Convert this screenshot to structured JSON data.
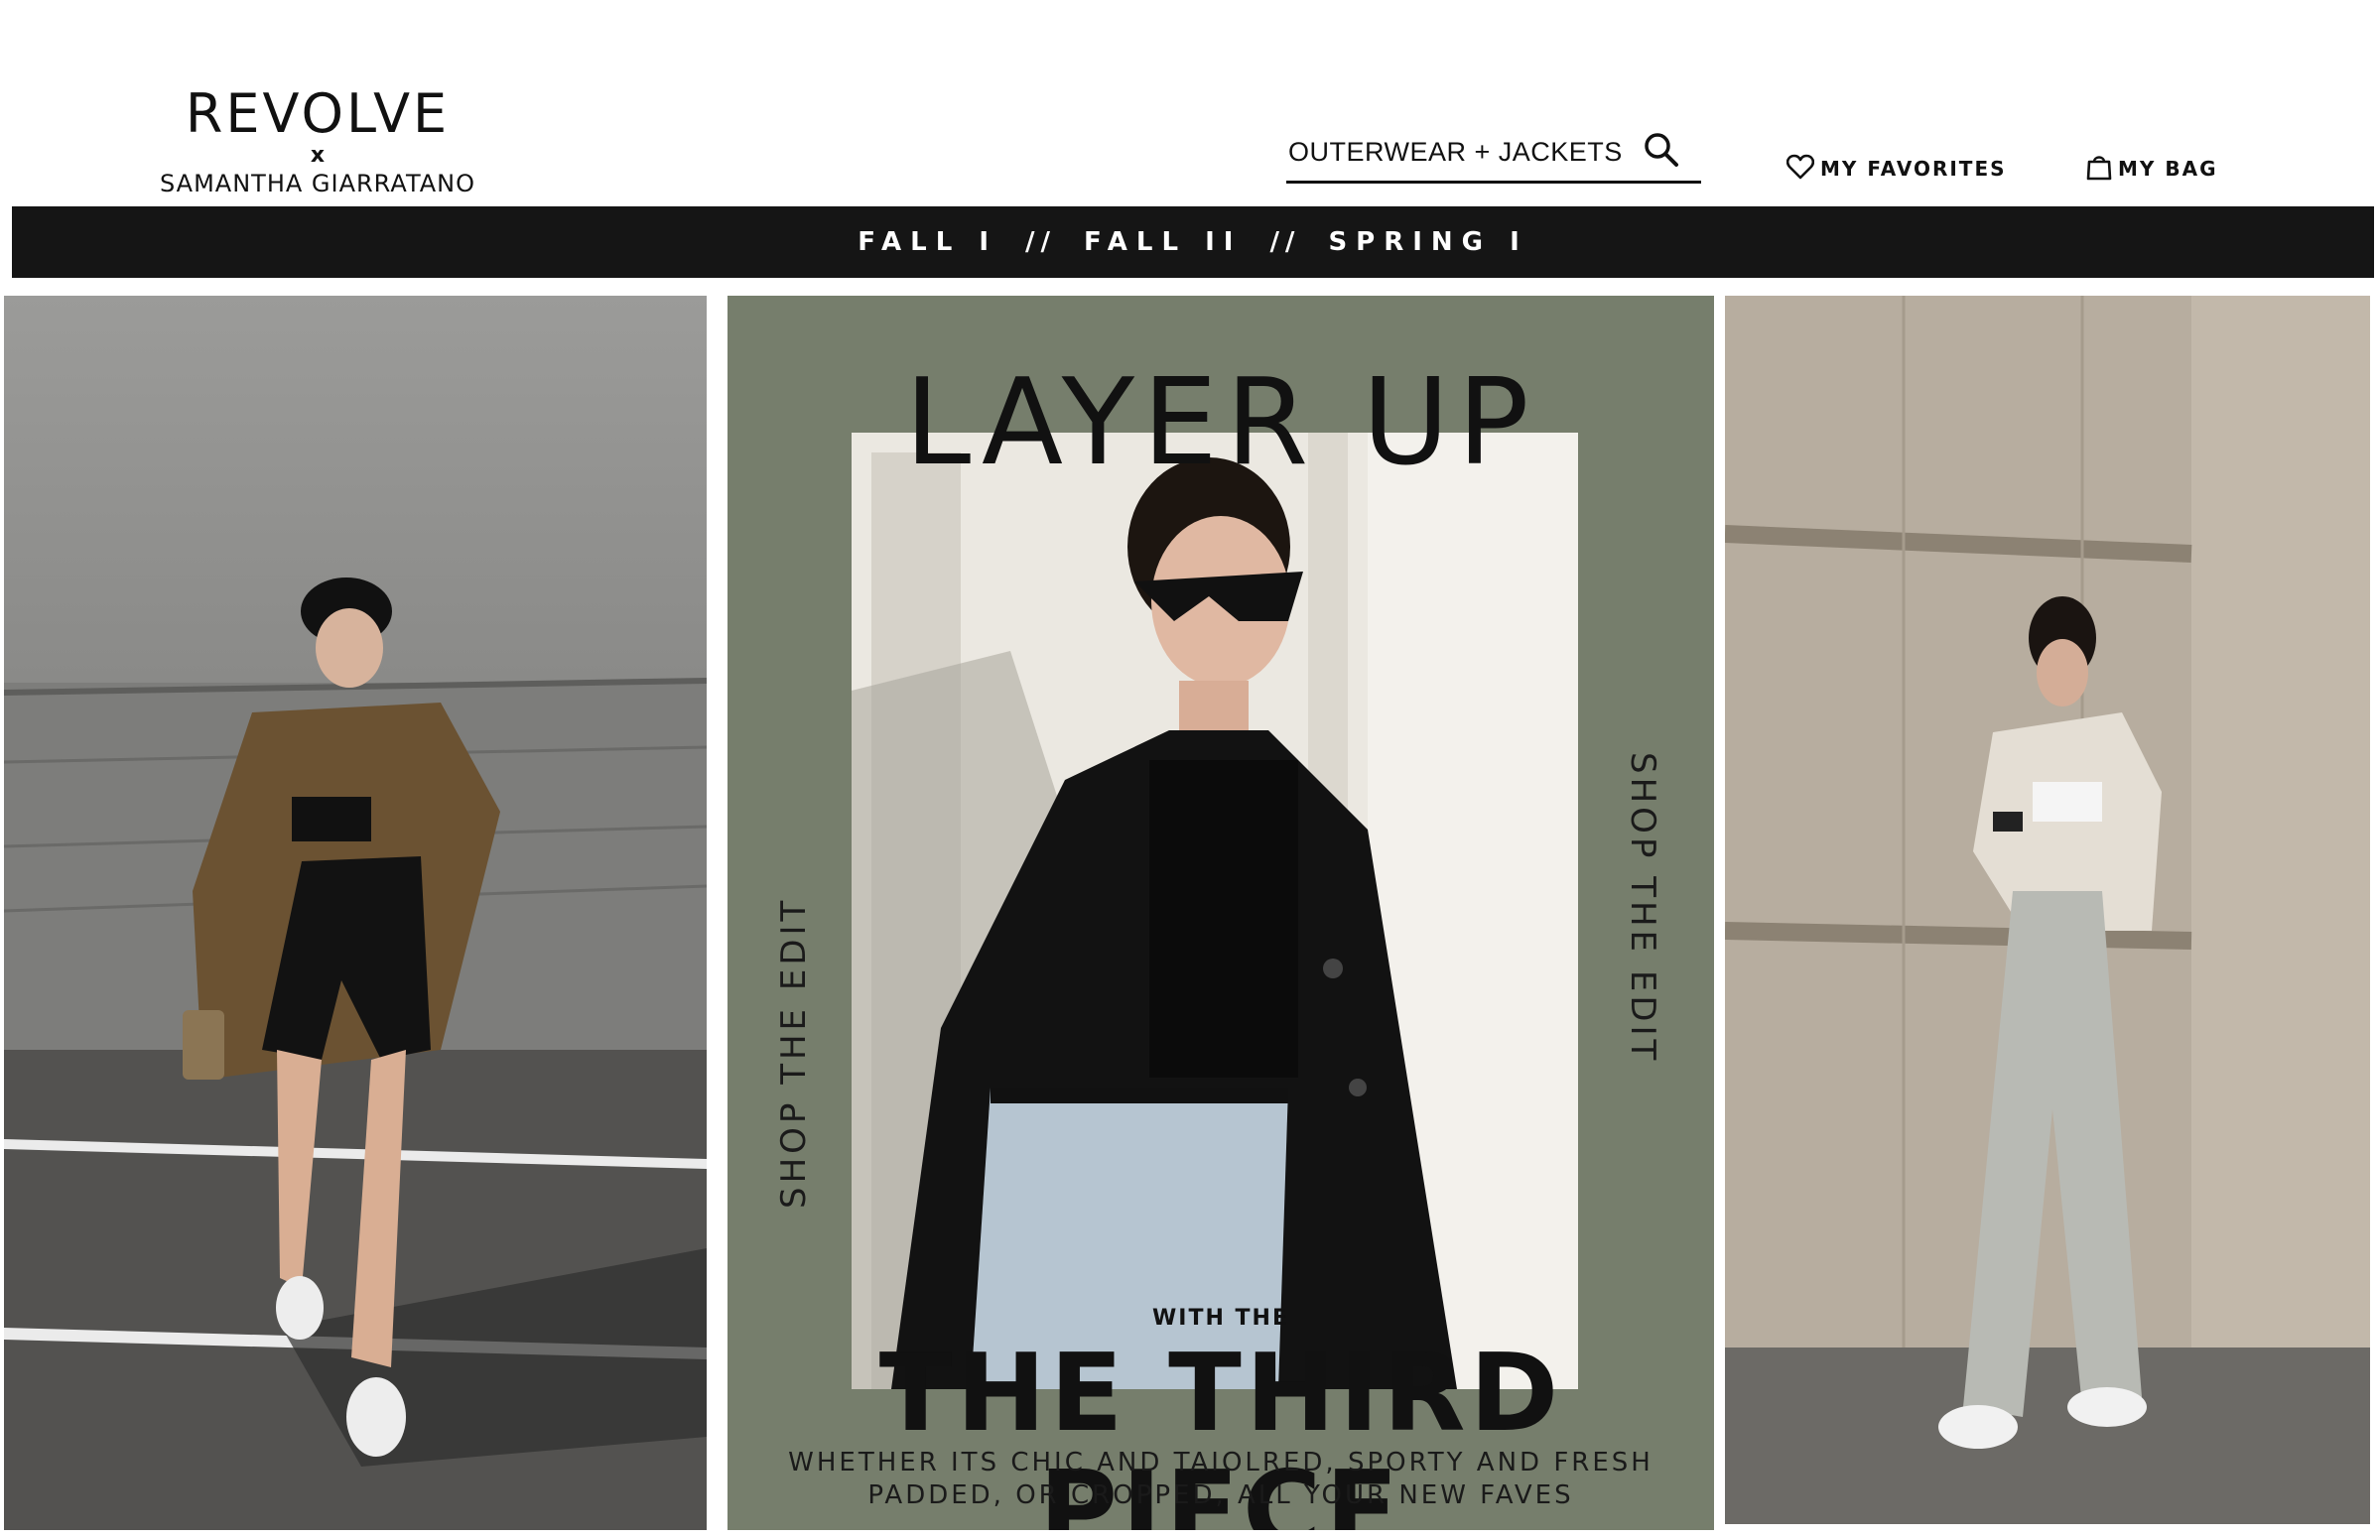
{
  "brand": {
    "name": "REVOLVE",
    "separator": "x",
    "collab": "SAMANTHA GIARRATANO"
  },
  "search": {
    "value": "OUTERWEAR + JACKETS",
    "icon": "search-icon"
  },
  "utility": {
    "favorites_label": "MY FAVORITES",
    "favorites_icon": "heart-icon",
    "bag_label": "MY BAG",
    "bag_icon": "shopping-bag-icon"
  },
  "nav": {
    "items": [
      "FALL I",
      "FALL II",
      "SPRING I"
    ],
    "separators": [
      "//",
      "//"
    ]
  },
  "hero": {
    "headline_top": "LAYER UP",
    "kicker": "WITH THE",
    "headline_bottom": "THE THIRD PIECE",
    "description_lines": [
      "WHETHER ITS CHIC AND TAIOLRED, SPORTY AND FRESH",
      "PADDED, OR CROPPED, ALL YOUR NEW FAVES"
    ],
    "side_left": "SHOP THE EDIT",
    "side_right": "SHOP THE EDIT",
    "accent_color": "#767e6c"
  },
  "colors": {
    "navbar_bg": "#151515",
    "text": "#111111"
  }
}
